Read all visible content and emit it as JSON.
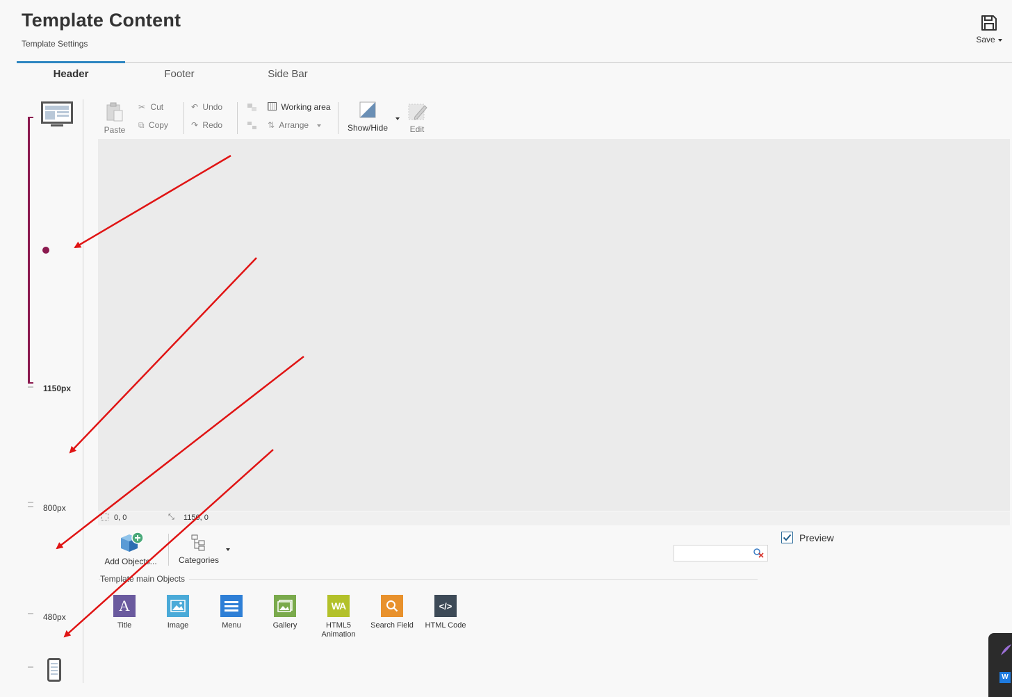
{
  "header": {
    "title": "Template Content",
    "subtitle": "Template Settings",
    "save_label": "Save"
  },
  "tabs": [
    {
      "label": "Header",
      "active": true
    },
    {
      "label": "Footer",
      "active": false
    },
    {
      "label": "Side Bar",
      "active": false
    }
  ],
  "breakpoints": {
    "bp1": "1150px",
    "bp2": "800px",
    "bp3": "480px"
  },
  "toolbar": {
    "paste": "Paste",
    "cut": "Cut",
    "copy": "Copy",
    "undo": "Undo",
    "redo": "Redo",
    "working_area": "Working area",
    "arrange": "Arrange",
    "show_hide": "Show/Hide",
    "edit": "Edit"
  },
  "status": {
    "coord_a": "0, 0",
    "coord_b": "1150, 0"
  },
  "objects_panel": {
    "add_objects": "Add Objects...",
    "categories": "Categories",
    "section_title": "Template main Objects",
    "preview_label": "Preview",
    "preview_checked": true,
    "items": [
      {
        "label": "Title",
        "icon": "title-icon",
        "color": "#6a5a9e"
      },
      {
        "label": "Image",
        "icon": "image-icon",
        "color": "#4aaad8"
      },
      {
        "label": "Menu",
        "icon": "menu-icon",
        "color": "#2e7fd6"
      },
      {
        "label": "Gallery",
        "icon": "gallery-icon",
        "color": "#7aaa4c"
      },
      {
        "label": "HTML5 Animation",
        "icon": "html5-animation-icon",
        "color": "#b3c12a"
      },
      {
        "label": "Search Field",
        "icon": "search-field-icon",
        "color": "#e8912c"
      },
      {
        "label": "HTML Code",
        "icon": "html-code-icon",
        "color": "#3d4a57"
      }
    ]
  },
  "colors": {
    "accent": "#2e86c1",
    "rail_active": "#8b1a4f",
    "annotation_arrow": "#e01414"
  }
}
